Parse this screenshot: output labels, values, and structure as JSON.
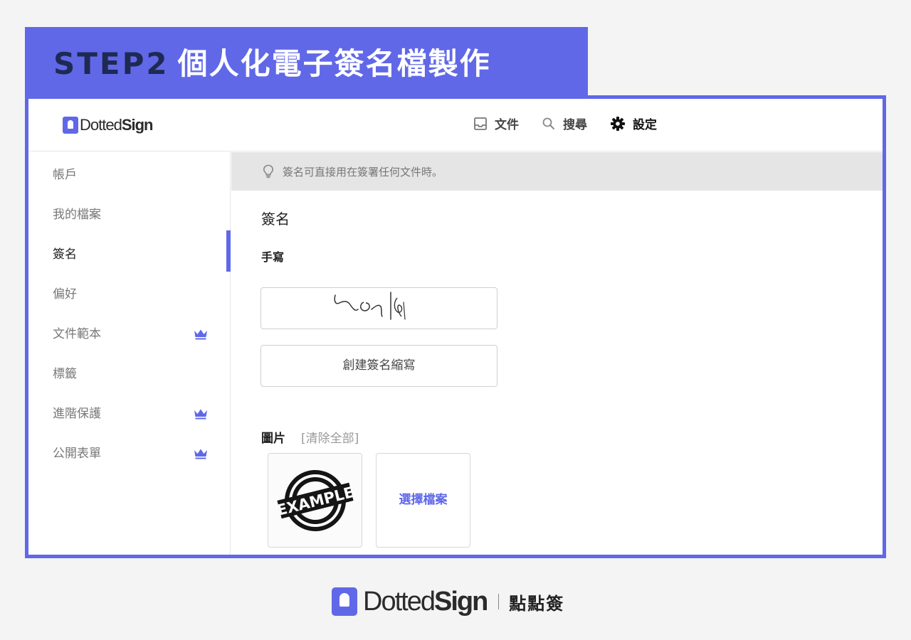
{
  "banner": {
    "step": "STEP2",
    "title": "個人化電子簽名檔製作"
  },
  "app": {
    "logo_light": "Dotted",
    "logo_bold": "Sign"
  },
  "nav": [
    {
      "label": "文件",
      "icon": "inbox-icon"
    },
    {
      "label": "搜尋",
      "icon": "search-icon"
    },
    {
      "label": "設定",
      "icon": "gear-icon"
    }
  ],
  "sidebar": {
    "items": [
      {
        "label": "帳戶",
        "premium": false
      },
      {
        "label": "我的檔案",
        "premium": false
      },
      {
        "label": "簽名",
        "premium": false,
        "active": true
      },
      {
        "label": "偏好",
        "premium": false
      },
      {
        "label": "文件範本",
        "premium": true
      },
      {
        "label": "標籤",
        "premium": false
      },
      {
        "label": "進階保護",
        "premium": true
      },
      {
        "label": "公開表單",
        "premium": true
      }
    ]
  },
  "tip": {
    "text": "簽名可直接用在簽署任何文件時。",
    "icon": "lightbulb-icon"
  },
  "signature": {
    "section_title": "簽名",
    "handwritten_label": "手寫",
    "initials_button": "創建簽名縮寫",
    "image_label": "圖片",
    "clear_all": "[清除全部]",
    "stamp_text": "EXAMPLE",
    "choose_file": "選擇檔案"
  },
  "footer": {
    "logo_light": "Dotted",
    "logo_bold": "Sign",
    "brand_cn": "點點簽"
  },
  "colors": {
    "accent": "#6068e8",
    "banner_step": "#1e2a52",
    "tip_bg": "#e5e5e5"
  }
}
